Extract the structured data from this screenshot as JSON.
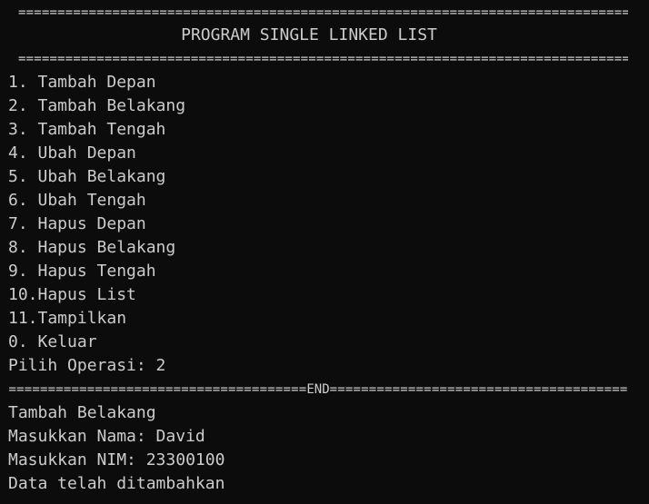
{
  "terminal": {
    "header_separator": "================================================================================",
    "title": "PROGRAM SINGLE LINKED LIST",
    "menu": [
      "1. Tambah Depan",
      "2. Tambah Belakang",
      "3. Tambah Tengah",
      "4. Ubah Depan",
      "5. Ubah Belakang",
      "6. Ubah Tengah",
      "7. Hapus Depan",
      "8. Hapus Belakang",
      "9. Hapus Tengah",
      "10.Hapus List",
      "11.Tampilkan",
      "0. Keluar"
    ],
    "prompt": "Pilih Operasi: 2",
    "end_separator_left": "========================================",
    "end_label": "END",
    "end_separator_right": "========================================",
    "output": [
      "Tambah Belakang",
      "Masukkan Nama: David",
      "Masukkan NIM: 23300100",
      "Data telah ditambahkan"
    ],
    "colors": {
      "background": "#0c0c0c",
      "foreground": "#cccccc"
    }
  }
}
